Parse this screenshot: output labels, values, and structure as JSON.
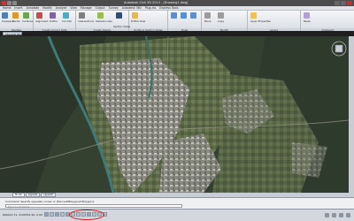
{
  "titlebar": {
    "title": "Autodesk Civil 3D 2013 - [Drawing1.dwg]"
  },
  "menubar": {
    "items": [
      "Home",
      "Insert",
      "Annotate",
      "Modify",
      "Analyze",
      "View",
      "Manage",
      "Output",
      "Survey",
      "Autodesk 360",
      "Plug-ins",
      "Express Tools"
    ]
  },
  "ribbon": {
    "panels": [
      {
        "label": "Palettes"
      },
      {
        "label": "Create Ground Data"
      },
      {
        "label": "Create Design"
      },
      {
        "label": "Profile & Section Views"
      },
      {
        "label": "Draw"
      },
      {
        "label": "Modify"
      },
      {
        "label": "Layers"
      },
      {
        "label": "Clipboard"
      }
    ],
    "buttons": {
      "toolspace": "Toolspace",
      "points": "Points",
      "surfaces": "Surfaces",
      "alignment": "Alignment",
      "profile": "Profile",
      "corridor": "Corridor",
      "intersections": "Intersections",
      "sample_lines": "Sample Lines",
      "section_views": "Section Views",
      "profile_view": "Profile View",
      "move": "Move",
      "copy": "Copy",
      "layer_properties": "Layer Properties",
      "paste": "Paste"
    }
  },
  "doc_tab": {
    "label": "[Top][2D Wireframe]"
  },
  "layout_tabs": [
    "Model",
    "Layout1",
    "Layout2"
  ],
  "command_line": {
    "history": "Command: Specify opposite corner or [Fence/WPolygon/CPolygon]:",
    "placeholder": "Type a command"
  },
  "status": {
    "coords": "666413.71, 5106352.50, 0.00"
  },
  "colors": {
    "annotation_circle": "#e01919",
    "ribbon_bg": "#e4e7eb",
    "title_bg": "#4c4c4c"
  }
}
